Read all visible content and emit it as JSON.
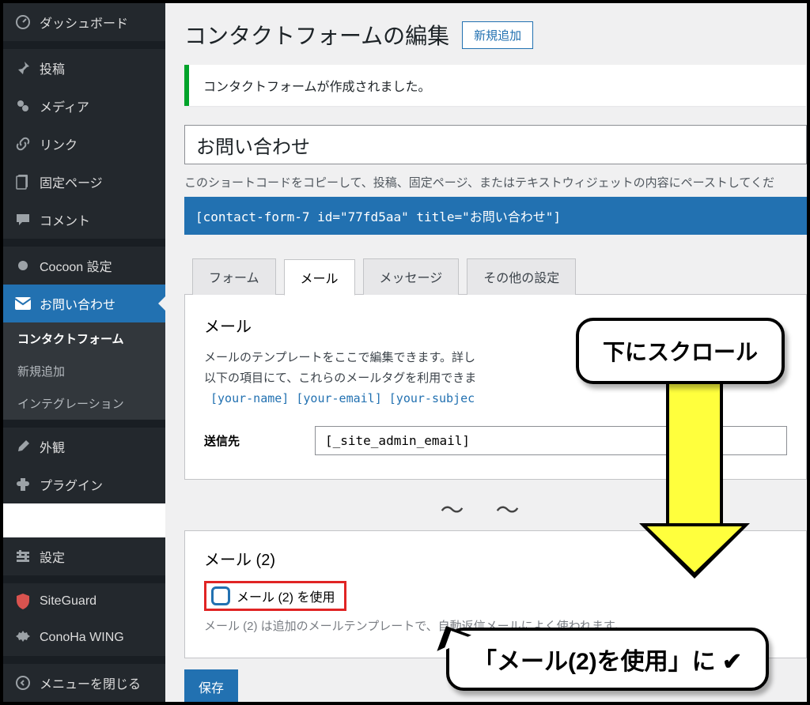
{
  "sidebar": {
    "items": [
      {
        "icon": "dashboard",
        "label": "ダッシュボード"
      },
      {
        "icon": "pin",
        "label": "投稿"
      },
      {
        "icon": "media",
        "label": "メディア"
      },
      {
        "icon": "link",
        "label": "リンク"
      },
      {
        "icon": "page",
        "label": "固定ページ"
      },
      {
        "icon": "comment",
        "label": "コメント"
      },
      {
        "icon": "dot",
        "label": "Cocoon 設定"
      },
      {
        "icon": "mail",
        "label": "お問い合わせ",
        "current": true
      },
      {
        "icon": "brush",
        "label": "外観"
      },
      {
        "icon": "plugin",
        "label": "プラグイン"
      },
      {
        "icon": "settings",
        "label": "設定"
      },
      {
        "icon": "shield",
        "label": "SiteGuard"
      },
      {
        "icon": "gear",
        "label": "ConoHa WING"
      },
      {
        "icon": "collapse",
        "label": "メニューを閉じる"
      }
    ],
    "submenu": {
      "items": [
        {
          "label": "コンタクトフォーム",
          "active": true
        },
        {
          "label": "新規追加"
        },
        {
          "label": "インテグレーション"
        }
      ]
    }
  },
  "page": {
    "title": "コンタクトフォームの編集",
    "add_new": "新規追加",
    "notice": "コンタクトフォームが作成されました。",
    "form_title": "お問い合わせ",
    "helper": "このショートコードをコピーして、投稿、固定ページ、またはテキストウィジェットの内容にペーストしてくだ",
    "shortcode": "[contact-form-7 id=\"77fd5aa\" title=\"お問い合わせ\"]"
  },
  "tabs": {
    "t1": "フォーム",
    "t2": "メール",
    "t3": "メッセージ",
    "t4": "その他の設定"
  },
  "mail": {
    "heading": "メール",
    "desc1": "メールのテンプレートをここで編集できます。詳し",
    "desc2": "以下の項目にて、これらのメールタグを利用できま",
    "tags": "[your-name] [your-email] [your-subjec",
    "to_label": "送信先",
    "to_value": "[_site_admin_email]"
  },
  "mail2": {
    "heading": "メール (2)",
    "use_label": "メール (2) を使用",
    "sub": "メール (2) は追加のメールテンプレートで、自動返信メールによく使われます。"
  },
  "save": "保存",
  "annot": {
    "scroll": "下にスクロール",
    "check": "「メール(2)を使用」に ✔"
  }
}
